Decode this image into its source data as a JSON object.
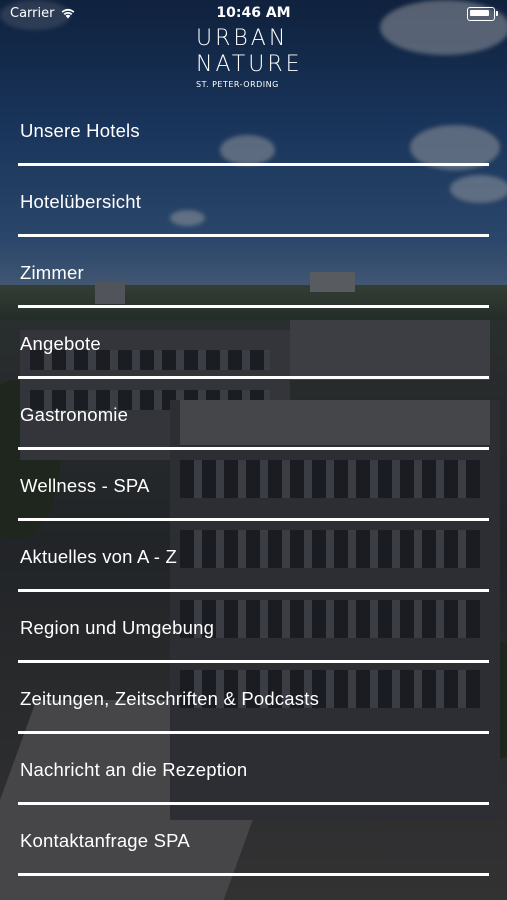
{
  "status_bar": {
    "carrier": "Carrier",
    "time": "10:46 AM",
    "wifi_icon": "wifi-icon",
    "battery_icon": "battery-icon"
  },
  "logo": {
    "line1": "URBAN",
    "line2": "NATURE",
    "subtitle": "ST. PETER-ORDING"
  },
  "menu": {
    "items": [
      {
        "label": "Unsere Hotels"
      },
      {
        "label": "Hotelübersicht"
      },
      {
        "label": "Zimmer"
      },
      {
        "label": "Angebote"
      },
      {
        "label": "Gastronomie"
      },
      {
        "label": "Wellness - SPA"
      },
      {
        "label": "Aktuelles von A - Z"
      },
      {
        "label": "Region und Umgebung"
      },
      {
        "label": "Zeitungen, Zeitschriften & Podcasts"
      },
      {
        "label": "Nachricht an die Rezeption"
      },
      {
        "label": "Kontaktanfrage SPA"
      }
    ]
  },
  "colors": {
    "text": "#ffffff",
    "divider": "#ffffff",
    "sky": "#1d4a86"
  }
}
